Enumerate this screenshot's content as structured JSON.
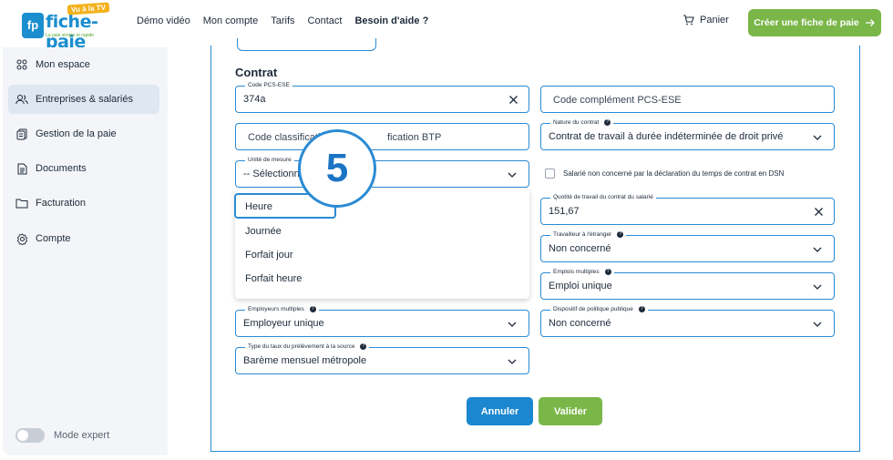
{
  "header": {
    "logo_name": "fiche-paie",
    "logo_badge": "Vu à la TV",
    "logo_tagline": "La paie simple et rapide",
    "nav": [
      "Démo vidéo",
      "Mon compte",
      "Tarifs",
      "Contact",
      "Besoin d'aide ?"
    ],
    "cart_label": "Panier",
    "cta_label": "Créer une fiche de paie"
  },
  "sidebar": {
    "items": [
      {
        "label": "Mon espace",
        "icon": "dashboard-icon"
      },
      {
        "label": "Entreprises & salariés",
        "icon": "users-icon",
        "active": true
      },
      {
        "label": "Gestion de la paie",
        "icon": "payroll-icon"
      },
      {
        "label": "Documents",
        "icon": "document-icon"
      },
      {
        "label": "Facturation",
        "icon": "folder-icon"
      },
      {
        "label": "Compte",
        "icon": "gear-icon"
      }
    ],
    "expert_mode_label": "Mode expert",
    "expert_mode_on": false
  },
  "form": {
    "section_title": "Contrat",
    "pcs_ese": {
      "label": "Code PCS-ESE",
      "value": "374a"
    },
    "pcs_ese_complement": {
      "placeholder": "Code complément PCS-ESE"
    },
    "classification_btp": {
      "placeholder": "Code classification BTP",
      "visible_left": "Code classificati",
      "visible_right": "fication BTP"
    },
    "nature_contrat": {
      "label": "Nature du contrat",
      "value": "Contrat de travail à durée indéterminée de droit privé"
    },
    "unite_mesure": {
      "label": "Unité de mesure",
      "value": "-- Sélectionn"
    },
    "dsn_checkbox": {
      "label": "Salarié non concerné par la déclaration du temps de contrat en DSN",
      "checked": false
    },
    "quotite": {
      "label": "Quotité de travail du contrat du salarié",
      "value": "151,67"
    },
    "travailleur_etranger": {
      "label": "Travailleur à l'étranger",
      "value": "Non concerné"
    },
    "emplois_multiples": {
      "label": "Emplois multiples",
      "value": "Emploi unique"
    },
    "employeurs_multiples": {
      "label": "Employeurs multiples",
      "value": "Employeur unique"
    },
    "politique_publique": {
      "label": "Dispositif de politique publique",
      "value": "Non concerné"
    },
    "taux_prelevement": {
      "label": "Type du taux du prélèvement à la source",
      "value": "Barème mensuel métropole"
    },
    "dropdown_options": [
      "Heure",
      "Journée",
      "Forfait jour",
      "Forfait heure"
    ],
    "cancel_label": "Annuler",
    "submit_label": "Valider"
  },
  "step_badge": "5",
  "colors": {
    "accent": "#2a8bd4",
    "green": "#7ab648",
    "sidebar_bg": "#f3f5f8"
  }
}
